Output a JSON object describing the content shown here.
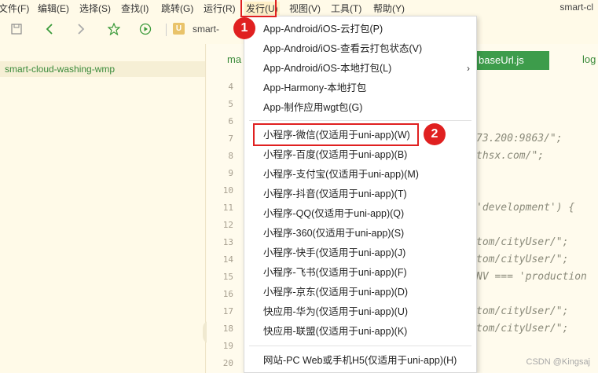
{
  "menubar": {
    "items": [
      "文件(F)",
      "编辑(E)",
      "选择(S)",
      "查找(I)",
      "跳转(G)",
      "运行(R)",
      "发行(U)",
      "视图(V)",
      "工具(T)",
      "帮助(Y)"
    ],
    "window_title": "smart-cl"
  },
  "toolbar": {
    "project_badge": "U",
    "breadcrumb": "smart-"
  },
  "sidebar": {
    "project_name": "smart-cloud-washing-wmp",
    "collapse_glyph": "‹"
  },
  "editor": {
    "tab_left": "ma",
    "tab_active": "baseUrl.js",
    "tab_right": "log",
    "line_numbers": [
      "4",
      "5",
      "6",
      "7",
      "8",
      "9",
      "10",
      "11",
      "12",
      "13",
      "14",
      "15",
      "16",
      "17",
      "18",
      "19",
      "20"
    ],
    "code_fragments": [
      {
        "line": "7",
        "text": "73.200:9863/\";"
      },
      {
        "line": "8",
        "text": "thsx.com/\";"
      },
      {
        "line": "11",
        "text": "'development') {"
      },
      {
        "line": "13",
        "text": "tom/cityUser/\";"
      },
      {
        "line": "14",
        "text": "tom/cityUser/\";"
      },
      {
        "line": "15",
        "text": "NV === 'production"
      },
      {
        "line": "17",
        "text": "tom/cityUser/\";"
      },
      {
        "line": "18",
        "text": "tom/cityUser/\";"
      }
    ]
  },
  "dropdown": {
    "group1": [
      "App-Android/iOS-云打包(P)",
      "App-Android/iOS-查看云打包状态(V)",
      "App-Android/iOS-本地打包(L)",
      "App-Harmony-本地打包",
      "App-制作应用wgt包(G)"
    ],
    "submenu_arrow": "›",
    "group2": [
      "小程序-微信(仅适用于uni-app)(W)",
      "小程序-百度(仅适用于uni-app)(B)",
      "小程序-支付宝(仅适用于uni-app)(M)",
      "小程序-抖音(仅适用于uni-app)(T)",
      "小程序-QQ(仅适用于uni-app)(Q)",
      "小程序-360(仅适用于uni-app)(S)",
      "小程序-快手(仅适用于uni-app)(J)",
      "小程序-飞书(仅适用于uni-app)(F)",
      "小程序-京东(仅适用于uni-app)(D)",
      "快应用-华为(仅适用于uni-app)(U)",
      "快应用-联盟(仅适用于uni-app)(K)"
    ],
    "group3": [
      "网站-PC Web或手机H5(仅适用于uni-app)(H)"
    ]
  },
  "annotations": {
    "marker_1": "1",
    "marker_2": "2",
    "color": "#e02020"
  },
  "watermark": "CSDN @Kingsaj",
  "icons": [
    "save-icon",
    "back-arrow-icon",
    "forward-arrow-icon",
    "star-icon",
    "run-icon",
    "chevron-left-icon",
    "chevron-right-icon"
  ]
}
